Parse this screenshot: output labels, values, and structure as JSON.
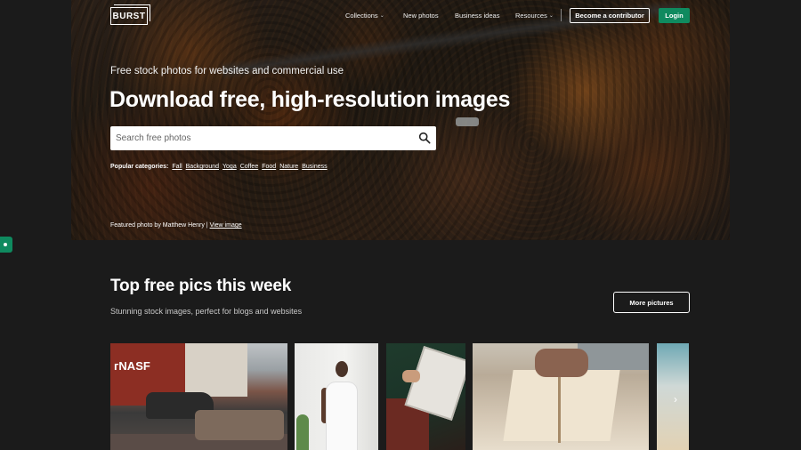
{
  "brand": {
    "logo": "BURST"
  },
  "nav": {
    "links": [
      "Collections",
      "New photos",
      "Business ideas",
      "Resources"
    ],
    "contributor_label": "Become a contributor",
    "login_label": "Login"
  },
  "hero": {
    "tagline": "Free stock photos for websites and commercial use",
    "headline": "Download free, high-resolution images",
    "search_placeholder": "Search free photos",
    "popular_label": "Popular categories:",
    "categories": [
      "Fall",
      "Background",
      "Yoga",
      "Coffee",
      "Food",
      "Nature",
      "Business"
    ],
    "featured_text": "Featured photo by Matthew Henry |",
    "featured_link": "View image"
  },
  "section": {
    "title": "Top free pics this week",
    "subtitle": "Stunning stock images, perfect for blogs and websites",
    "more_label": "More pictures"
  },
  "colors": {
    "accent": "#0f8a5f",
    "background": "#1b1b1b"
  },
  "icons": {
    "search": "search-icon",
    "next": "arrow-right-icon"
  }
}
